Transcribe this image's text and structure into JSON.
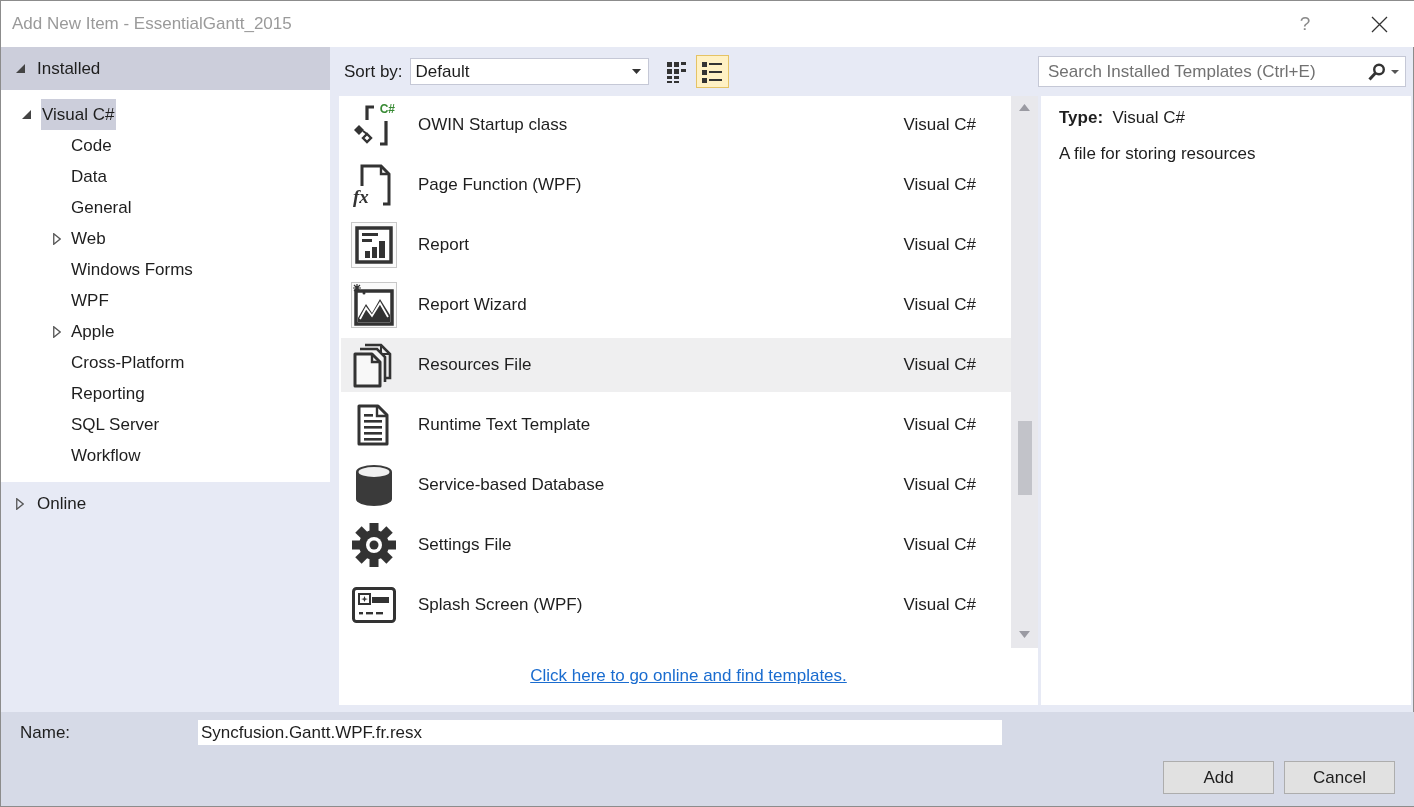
{
  "window": {
    "title": "Add New Item - EssentialGantt_2015",
    "help_button": "?"
  },
  "sidebar": {
    "sections": [
      {
        "label": "Installed",
        "expanded": true,
        "children": [
          {
            "label": "Visual C#",
            "kind": "folder",
            "expanded": true,
            "selected": true,
            "children": [
              {
                "label": "Code",
                "kind": "leaf",
                "selected": false
              },
              {
                "label": "Data",
                "kind": "leaf",
                "selected": false
              },
              {
                "label": "General",
                "kind": "leaf",
                "selected": false
              },
              {
                "label": "Web",
                "kind": "folder",
                "expanded": false,
                "selected": false
              },
              {
                "label": "Windows Forms",
                "kind": "leaf",
                "selected": false
              },
              {
                "label": "WPF",
                "kind": "leaf",
                "selected": false
              },
              {
                "label": "Apple",
                "kind": "folder",
                "expanded": false,
                "selected": false
              },
              {
                "label": "Cross-Platform",
                "kind": "leaf",
                "selected": false
              },
              {
                "label": "Reporting",
                "kind": "leaf",
                "selected": false
              },
              {
                "label": "SQL Server",
                "kind": "leaf",
                "selected": false
              },
              {
                "label": "Workflow",
                "kind": "leaf",
                "selected": false
              }
            ]
          }
        ]
      },
      {
        "label": "Online",
        "expanded": false
      }
    ]
  },
  "toolbar": {
    "sort_label": "Sort by:",
    "sort_value": "Default",
    "views": [
      {
        "kind": "grid",
        "selected": false
      },
      {
        "kind": "list",
        "selected": true
      }
    ]
  },
  "search": {
    "placeholder": "Search Installed Templates (Ctrl+E)"
  },
  "templates": [
    {
      "name": "OWIN Startup class",
      "type": "Visual C#",
      "kind": "owin",
      "icon_text": "C#",
      "selected": false
    },
    {
      "name": "Page Function (WPF)",
      "type": "Visual C#",
      "kind": "page-function",
      "icon_text": "fx",
      "selected": false
    },
    {
      "name": "Report",
      "type": "Visual C#",
      "kind": "report",
      "selected": false
    },
    {
      "name": "Report Wizard",
      "type": "Visual C#",
      "kind": "report-wizard",
      "selected": false
    },
    {
      "name": "Resources File",
      "type": "Visual C#",
      "kind": "resources",
      "selected": true
    },
    {
      "name": "Runtime Text Template",
      "type": "Visual C#",
      "kind": "text-template",
      "selected": false
    },
    {
      "name": "Service-based Database",
      "type": "Visual C#",
      "kind": "database",
      "selected": false
    },
    {
      "name": "Settings File",
      "type": "Visual C#",
      "kind": "settings",
      "selected": false
    },
    {
      "name": "Splash Screen (WPF)",
      "type": "Visual C#",
      "kind": "splash",
      "selected": false
    }
  ],
  "online_link": "Click here to go online and find templates.",
  "details": {
    "type_line": "**Type:**  Visual C#",
    "description": "A file for storing resources"
  },
  "name_field": {
    "label": "Name:",
    "value": "Syncfusion.Gantt.WPF.fr.resx"
  },
  "buttons": [
    "Add",
    "Cancel"
  ]
}
